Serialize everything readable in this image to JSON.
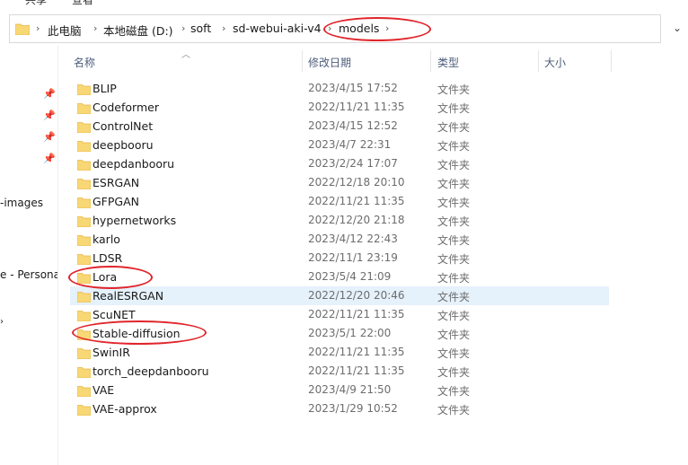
{
  "ribbon": {
    "tab_share": "共享",
    "tab_view": "查看"
  },
  "address": {
    "crumbs": [
      "此电脑",
      "本地磁盘 (D:)",
      "soft",
      "sd-webui-aki-v4",
      "models"
    ],
    "highlight_color": "#e0252b"
  },
  "nav_pane": {
    "item_images": "-images",
    "item_personal": "e - Persona"
  },
  "columns": {
    "name": "名称",
    "date": "修改日期",
    "type": "类型",
    "size": "大小"
  },
  "files": [
    {
      "name": "BLIP",
      "date": "2023/4/15 17:52",
      "type": "文件夹"
    },
    {
      "name": "Codeformer",
      "date": "2022/11/21 11:35",
      "type": "文件夹"
    },
    {
      "name": "ControlNet",
      "date": "2023/4/15 12:52",
      "type": "文件夹"
    },
    {
      "name": "deepbooru",
      "date": "2023/4/7 22:31",
      "type": "文件夹"
    },
    {
      "name": "deepdanbooru",
      "date": "2023/2/24 17:07",
      "type": "文件夹"
    },
    {
      "name": "ESRGAN",
      "date": "2022/12/18 20:10",
      "type": "文件夹"
    },
    {
      "name": "GFPGAN",
      "date": "2022/11/21 11:35",
      "type": "文件夹"
    },
    {
      "name": "hypernetworks",
      "date": "2022/12/20 21:18",
      "type": "文件夹"
    },
    {
      "name": "karlo",
      "date": "2023/4/12 22:43",
      "type": "文件夹"
    },
    {
      "name": "LDSR",
      "date": "2022/11/1 23:19",
      "type": "文件夹"
    },
    {
      "name": "Lora",
      "date": "2023/5/4 21:09",
      "type": "文件夹"
    },
    {
      "name": "RealESRGAN",
      "date": "2022/12/20 20:46",
      "type": "文件夹"
    },
    {
      "name": "ScuNET",
      "date": "2022/11/21 11:35",
      "type": "文件夹"
    },
    {
      "name": "Stable-diffusion",
      "date": "2023/5/1 22:00",
      "type": "文件夹"
    },
    {
      "name": "SwinIR",
      "date": "2022/11/21 11:35",
      "type": "文件夹"
    },
    {
      "name": "torch_deepdanbooru",
      "date": "2022/11/21 11:35",
      "type": "文件夹"
    },
    {
      "name": "VAE",
      "date": "2023/4/9 21:50",
      "type": "文件夹"
    },
    {
      "name": "VAE-approx",
      "date": "2023/1/29 10:52",
      "type": "文件夹"
    }
  ],
  "selected_row": "RealESRGAN",
  "highlighted_rows": [
    "Lora",
    "Stable-diffusion"
  ],
  "colors": {
    "selection": "#e5f1fb",
    "folder": "#f8d775",
    "folder_dark": "#e8b74a"
  }
}
